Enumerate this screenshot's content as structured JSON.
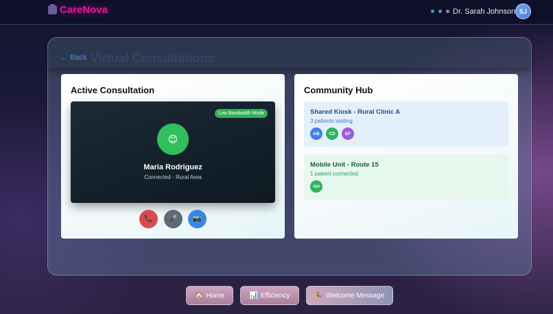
{
  "header": {
    "brand": "CareNova",
    "user_name": "Dr. Sarah Johnson",
    "user_initials": "SJ",
    "dot_colors": [
      "#3aa89a",
      "#6a8ad6",
      "#9b7ad0"
    ]
  },
  "page": {
    "back_label": "← Back",
    "title": "Virtual Consultations"
  },
  "active_consultation": {
    "title": "Active Consultation",
    "badge": "Low Bandwidth Mode",
    "avatar_emoji": "😊",
    "patient_name": "Maria Rodriguez",
    "status": "Connected - Rural Area",
    "controls": {
      "end_call_icon": "📞",
      "mic_icon": "🎤",
      "camera_icon": "📷"
    }
  },
  "community_hub": {
    "title": "Community Hub",
    "items": [
      {
        "name": "Shared Kiosk - Rural Clinic A",
        "subtitle": "3 patients waiting",
        "chips": [
          {
            "label": "AB",
            "color": "#3f82e8"
          },
          {
            "label": "CD",
            "color": "#2fb35c"
          },
          {
            "label": "EF",
            "color": "#9b59e6"
          }
        ]
      },
      {
        "name": "Mobile Unit - Route 15",
        "subtitle": "1 patient connected",
        "chips": [
          {
            "label": "GH",
            "color": "#2fb35c"
          }
        ]
      }
    ]
  },
  "bottom_nav": {
    "home_icon": "🏠",
    "home_label": "Home",
    "efficiency_icon": "📊",
    "efficiency_label": "Efficiency",
    "welcome_icon": "🎉",
    "welcome_label": "Welcome Message"
  }
}
